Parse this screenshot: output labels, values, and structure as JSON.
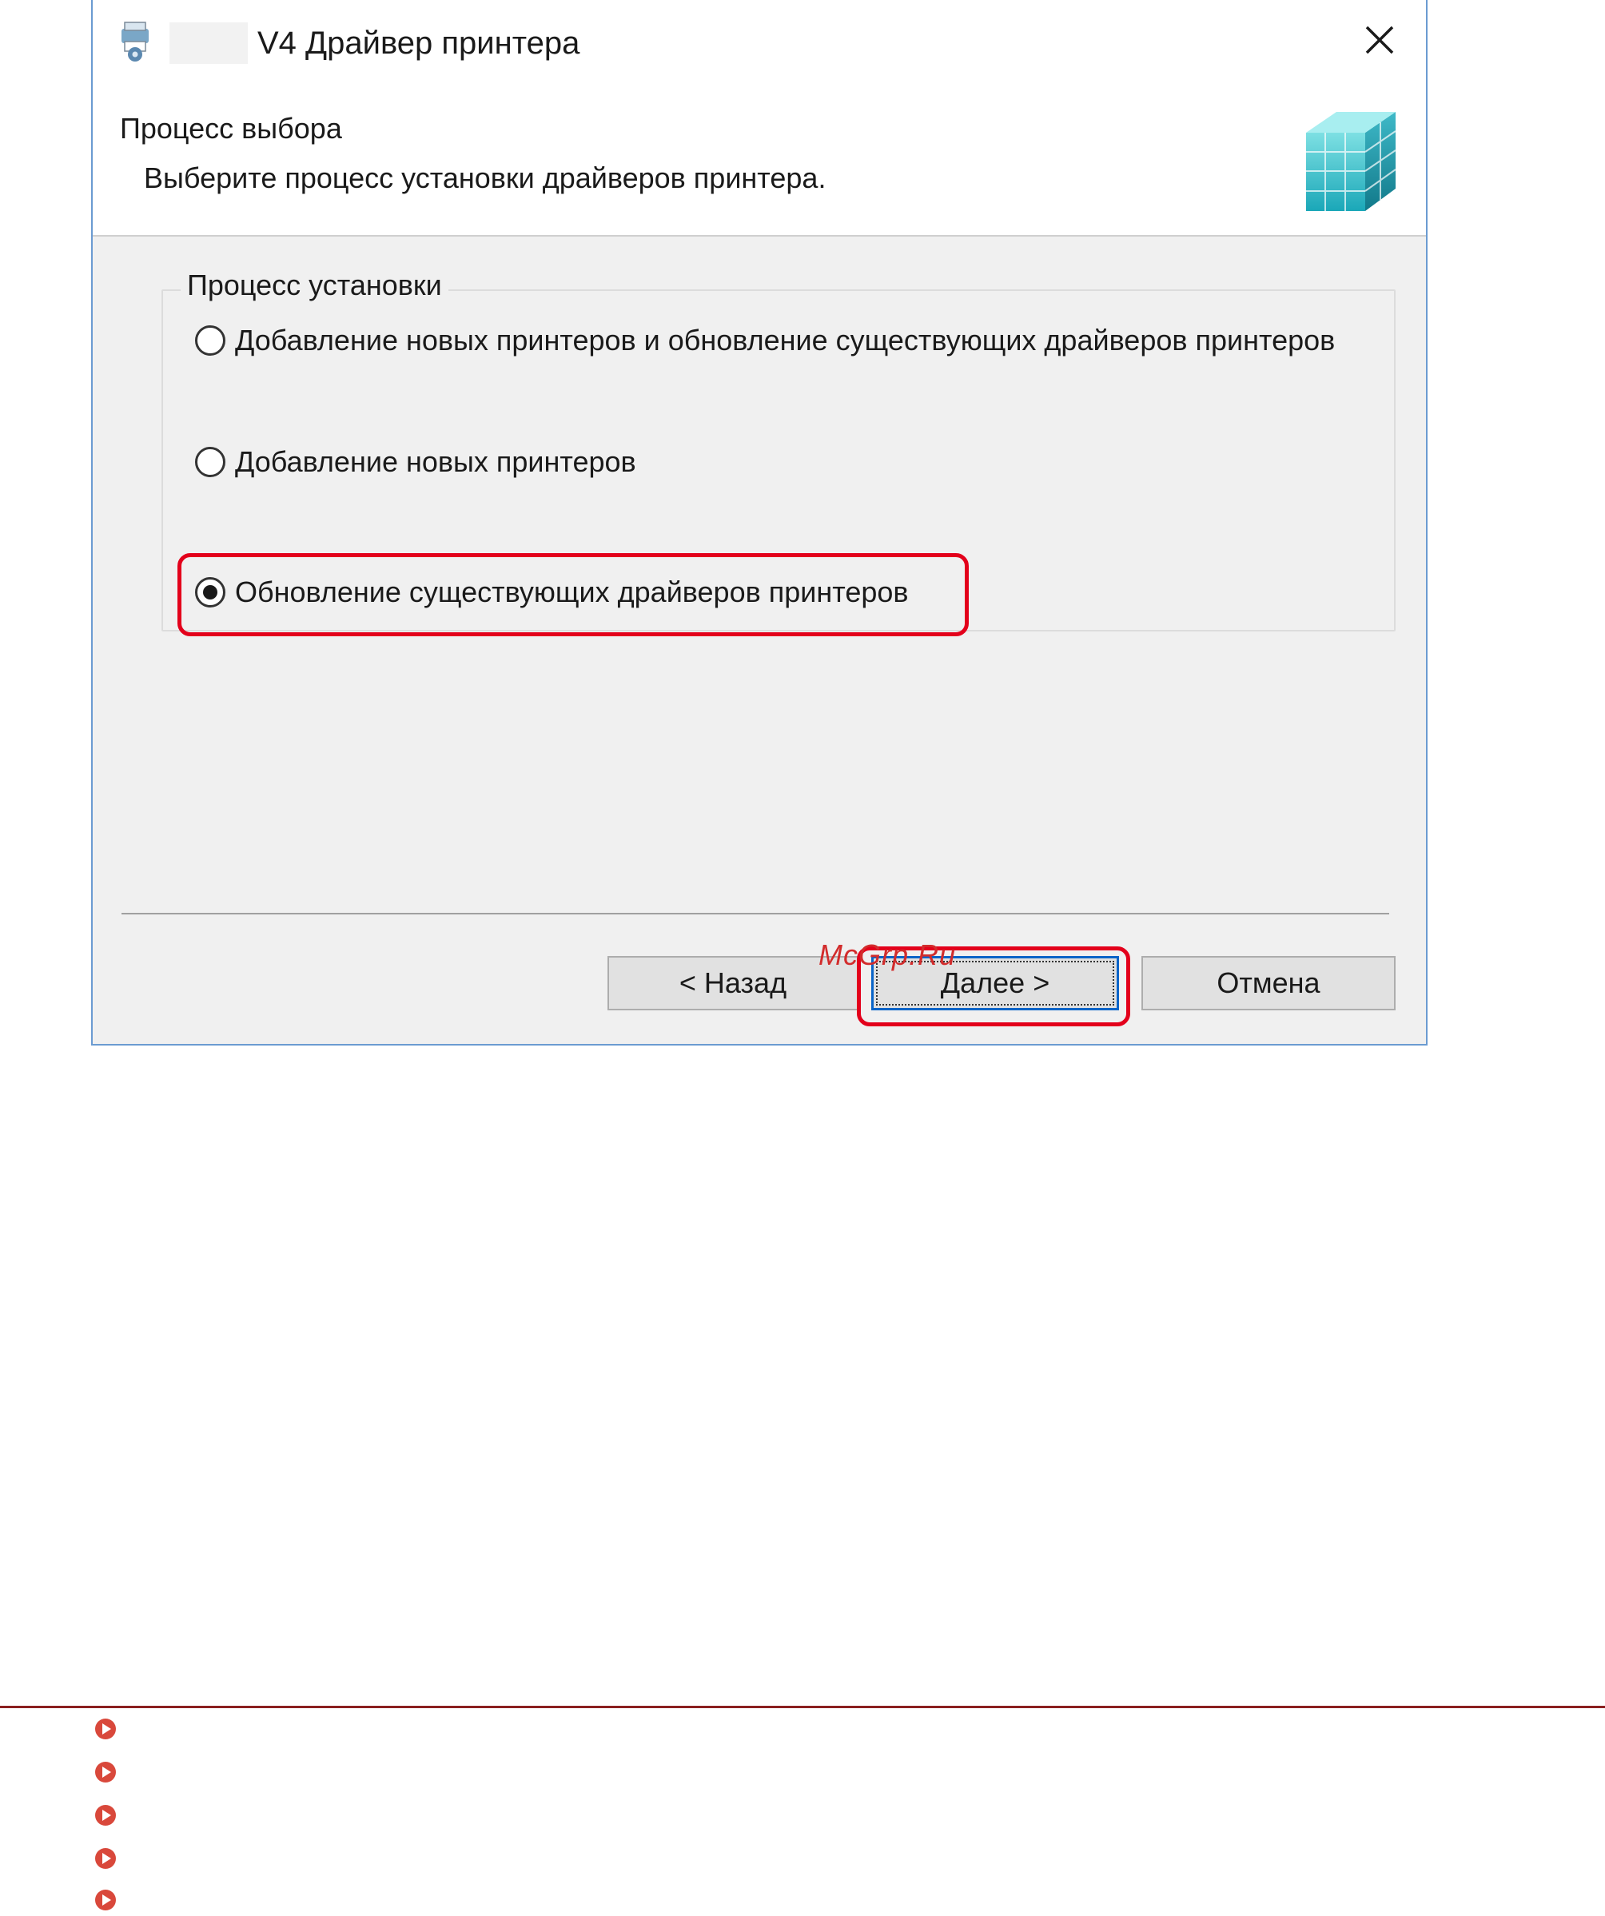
{
  "dialog": {
    "title": "V4 Драйвер принтера",
    "header_title": "Процесс выбора",
    "header_subtitle": "Выберите процесс установки драйверов принтера.",
    "group_label": "Процесс установки",
    "options": [
      {
        "label": "Добавление новых принтеров и обновление существующих драйверов принтеров",
        "checked": false
      },
      {
        "label": "Добавление новых принтеров",
        "checked": false
      },
      {
        "label": "Обновление существующих драйверов принтеров",
        "checked": true
      }
    ],
    "buttons": {
      "back": "< Назад",
      "next": "Далее >",
      "cancel": "Отмена"
    }
  },
  "watermark": "McGrp.Ru",
  "colors": {
    "highlight": "#e3001b",
    "accent": "#0a64c8",
    "bullet": "#d9483b",
    "rule": "#8b2020"
  }
}
